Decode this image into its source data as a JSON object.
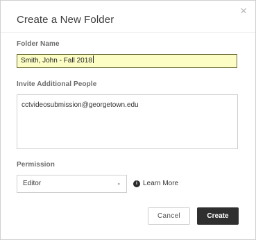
{
  "dialog": {
    "title": "Create a New Folder",
    "close_glyph": "×"
  },
  "folder_name": {
    "label": "Folder Name",
    "value": "Smith, John - Fall 2018"
  },
  "invite": {
    "label": "Invite Additional People",
    "value": "cctvideosubmission@georgetown.edu"
  },
  "permission": {
    "label": "Permission",
    "selected": "Editor",
    "arrow_glyph": "-",
    "info_glyph": "i",
    "learn_more": "Learn More"
  },
  "buttons": {
    "cancel": "Cancel",
    "create": "Create"
  },
  "colors": {
    "focused_input_bg": "#fbfdc4",
    "primary_button": "#2f2f2f"
  },
  "icons": {
    "close": "close-icon",
    "info": "info-icon",
    "dropdown": "chevron-down-icon"
  }
}
